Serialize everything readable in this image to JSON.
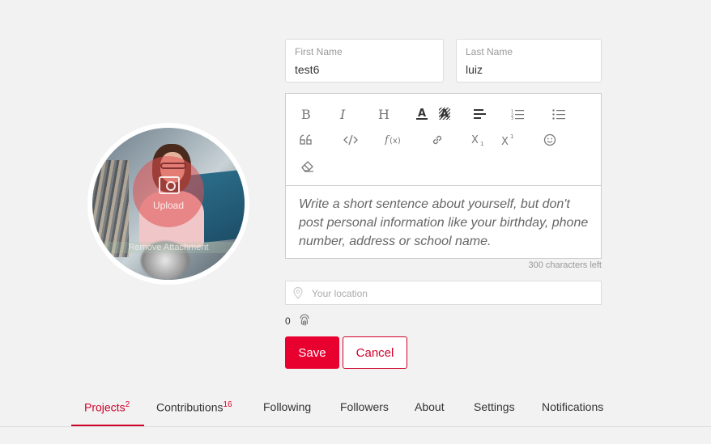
{
  "avatar": {
    "upload_label": "Upload",
    "remove_label": "Remove Attachment"
  },
  "first_name": {
    "label": "First Name",
    "value": "test6"
  },
  "last_name": {
    "label": "Last Name",
    "value": "luiz"
  },
  "editor": {
    "toolbar": [
      "bold-icon",
      "italic-icon",
      "heading-icon",
      "font-color-icon",
      "highlight-icon",
      "align-icon",
      "ordered-list-icon",
      "unordered-list-icon",
      "blockquote-icon",
      "code-icon",
      "formula-icon",
      "link-icon",
      "subscript-icon",
      "superscript-icon",
      "emoji-icon",
      "clear-format-icon"
    ],
    "placeholder": "Write a short sentence about yourself, but don't post personal information like your birthday, phone number, address or school name.",
    "chars_left": "300 characters left"
  },
  "location": {
    "placeholder": "Your location"
  },
  "fingerprint_count": "0",
  "buttons": {
    "save": "Save",
    "cancel": "Cancel"
  },
  "tabs": [
    {
      "label": "Projects",
      "badge": "2",
      "active": true
    },
    {
      "label": "Contributions",
      "badge": "16"
    },
    {
      "label": "Following"
    },
    {
      "label": "Followers"
    },
    {
      "label": "About"
    },
    {
      "label": "Settings"
    },
    {
      "label": "Notifications"
    }
  ],
  "colors": {
    "accent": "#e8002e",
    "background": "#f2f2f2"
  }
}
